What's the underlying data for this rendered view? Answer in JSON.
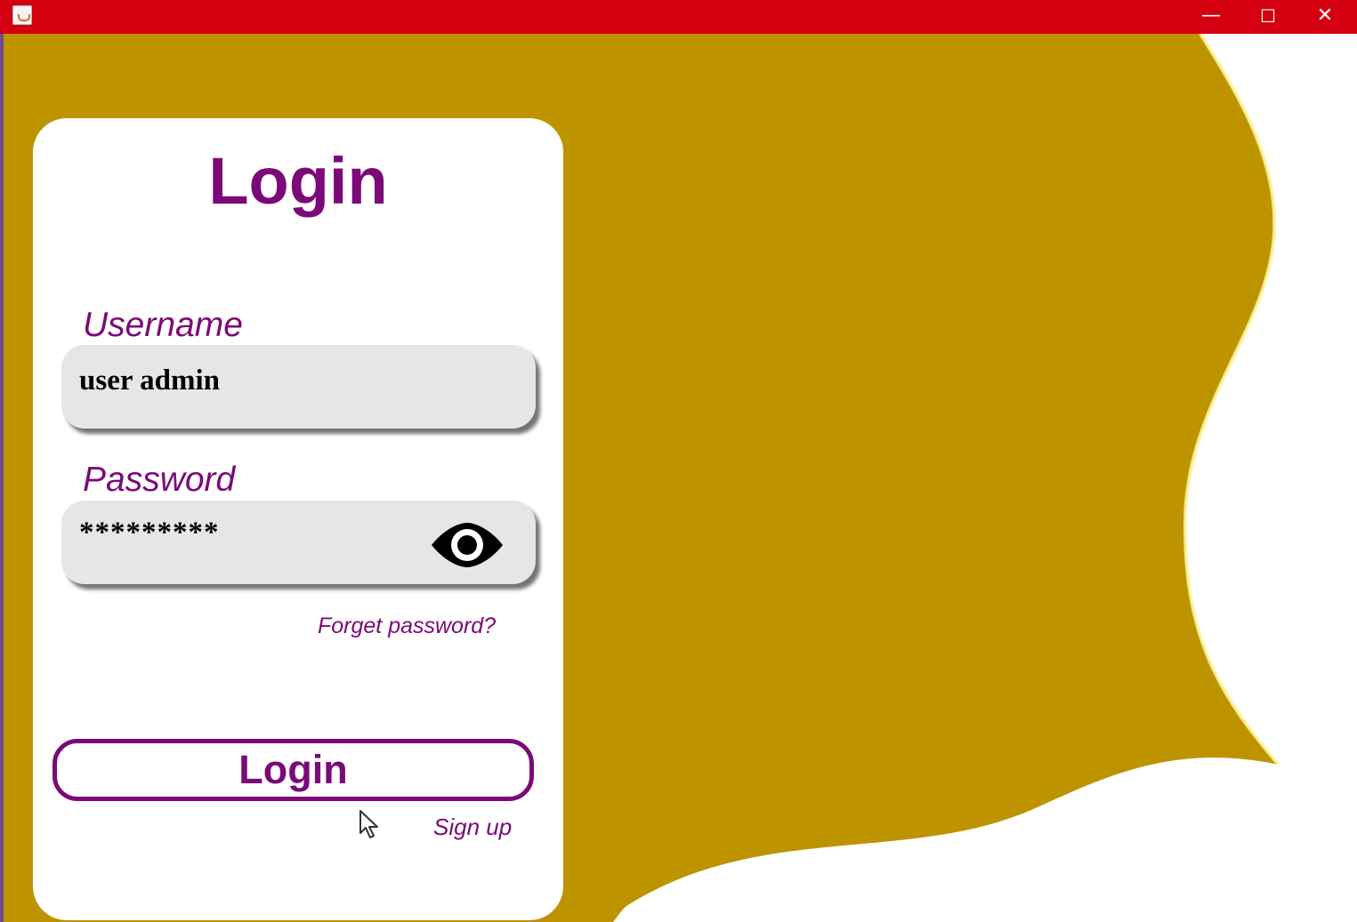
{
  "window": {
    "titlebar_color": "#d4000f",
    "icons": {
      "app": "java-app-icon",
      "minimize": "minimize-icon",
      "maximize": "maximize-icon",
      "close": "close-icon",
      "password_toggle": "eye-icon",
      "pointer": "mouse-cursor-icon"
    },
    "minimize_glyph": "—",
    "maximize_glyph": "☐",
    "close_glyph": "✕"
  },
  "colors": {
    "brand_purple": "#7b0a78",
    "background_gold": "#bd9400",
    "card_white": "#ffffff",
    "input_gray": "#e6e6e6"
  },
  "login": {
    "title": "Login",
    "username_label": "Username",
    "username_value": "user admin",
    "password_label": "Password",
    "password_value": "*********",
    "forgot_password": "Forget password?",
    "login_button": "Login",
    "signup_link": "Sign up"
  }
}
